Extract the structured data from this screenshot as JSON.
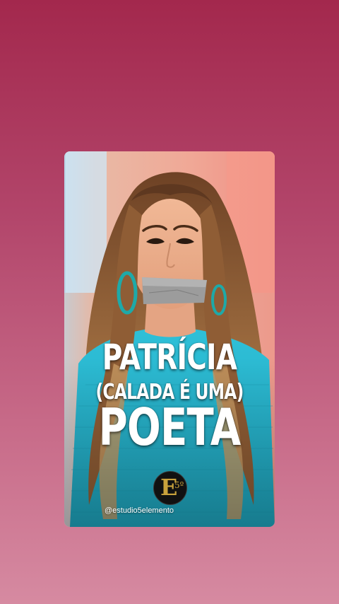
{
  "story": {
    "headline": {
      "line1": "PATRÍCIA",
      "line2": "(CALADA É UMA)",
      "line3": "POETA"
    },
    "logo": {
      "letter": "E",
      "number": "5º"
    },
    "handle": "@estudio5elemento"
  },
  "colors": {
    "background_top": "#a3284d",
    "background_bottom": "#d68aa1",
    "sweater": "#29b7cf",
    "hair": "#8a5a34",
    "tape": "#9a9a9a",
    "logo_gold": "#c9a23c"
  }
}
